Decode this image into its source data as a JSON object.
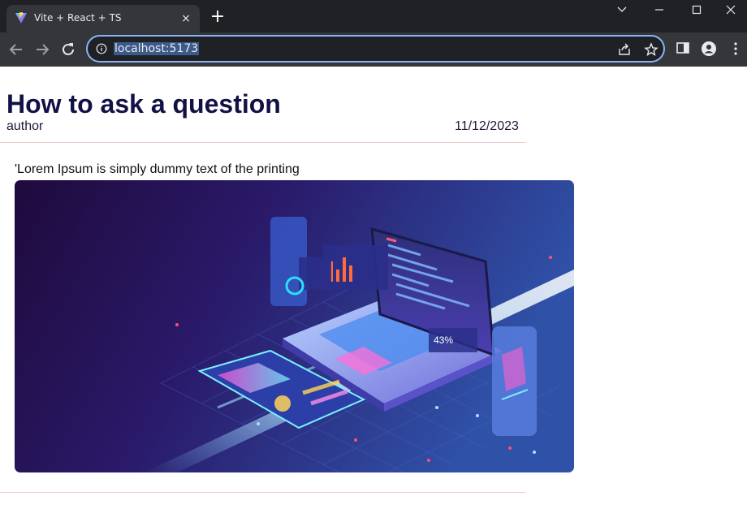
{
  "browser": {
    "tab_title": "Vite + React + TS",
    "tab_close": "×",
    "new_tab": "+",
    "url": "localhost:5173"
  },
  "post": {
    "title": "How to ask a question",
    "author": "author",
    "date": "11/12/2023",
    "body": "'Lorem Ipsum is simply dummy text of the printing",
    "image_icon": "laptop-tech-illustration"
  },
  "colors": {
    "chrome_dark": "#202124",
    "chrome_toolbar": "#35363a",
    "focus_ring": "#8ab4f8",
    "title_navy": "#111146",
    "divider_pink": "#f3c9d2"
  }
}
